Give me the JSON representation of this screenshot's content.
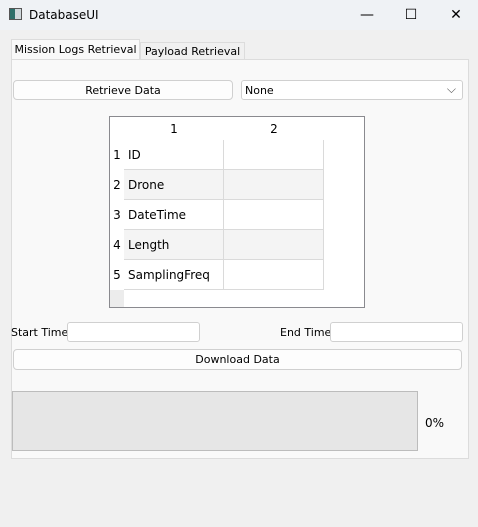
{
  "window": {
    "title": "DatabaseUI",
    "minimize": "—",
    "maximize": "☐",
    "close": "✕"
  },
  "tabs": [
    {
      "label": "Mission Logs Retrieval",
      "active": true
    },
    {
      "label": "Payload Retrieval",
      "active": false
    }
  ],
  "retrieve_button": "Retrieve Data",
  "dropdown": {
    "value": "None",
    "chevron": "⌵"
  },
  "table": {
    "columns": [
      "1",
      "2"
    ],
    "rows": [
      {
        "num": "1",
        "c1": "ID",
        "c2": ""
      },
      {
        "num": "2",
        "c1": "Drone",
        "c2": ""
      },
      {
        "num": "3",
        "c1": "DateTime",
        "c2": ""
      },
      {
        "num": "4",
        "c1": "Length",
        "c2": ""
      },
      {
        "num": "5",
        "c1": "SamplingFreq",
        "c2": ""
      }
    ]
  },
  "start_time": {
    "label": "Start Time",
    "value": ""
  },
  "end_time": {
    "label": "End Time",
    "value": ""
  },
  "download_button": "Download Data",
  "progress": {
    "value": 0,
    "text": "0%"
  }
}
